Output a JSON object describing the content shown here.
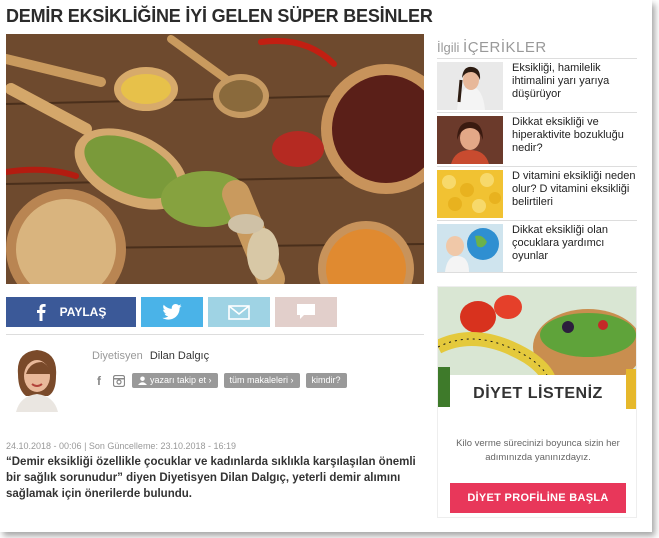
{
  "article": {
    "title": "DEMİR EKSİKLİĞİNE İYİ GELEN SÜPER BESİNLER",
    "meta": "24.10.2018 - 00:06 | Son Güncelleme: 23.10.2018 - 16:19",
    "lead": "“Demir eksikliği özellikle çocuklar ve kadınlarda sıklıkla karşılaşılan önemli bir sağlık sorunudur” diyen Diyetisyen Dilan Dalgıç, yeterli demir alımını sağlamak için önerilerde bulundu."
  },
  "share": {
    "facebook_label": "PAYLAŞ",
    "facebook_icon": "facebook-icon",
    "twitter_icon": "twitter-icon",
    "mail_icon": "mail-icon",
    "comment_icon": "comment-icon",
    "colors": {
      "facebook": "#3b5998",
      "twitter": "#4ab3e8",
      "mail": "#9fd3e4",
      "comment": "#e2cfcb"
    }
  },
  "author": {
    "role": "Diyetisyen",
    "name": "Dilan Dalgıç",
    "follow_label": "yazarı takip et ›",
    "articles_label": "tüm makaleleri ›",
    "who_label": "kimdir?"
  },
  "sidebar": {
    "title_a": "İlgili",
    "title_b": "İÇERİKLER",
    "items": [
      {
        "label": "Eksikliği, hamilelik ihtimalini yarı yarıya düşürüyor"
      },
      {
        "label": "Dikkat eksikliği ve hiperaktivite bozukluğu nedir?"
      },
      {
        "label": "D vitamini eksikliği neden olur? D vitamini eksikliği belirtileri"
      },
      {
        "label": "Dikkat eksikliği olan çocuklara yardımcı oyunlar"
      }
    ],
    "ad": {
      "title": "DİYET LİSTENİZ",
      "subtitle": "Kilo verme sürecinizi boyunca sizin her adımınızda yanınızdayız.",
      "button": "DİYET PROFİLİNE BAŞLA",
      "button_color": "#e8375a"
    }
  }
}
